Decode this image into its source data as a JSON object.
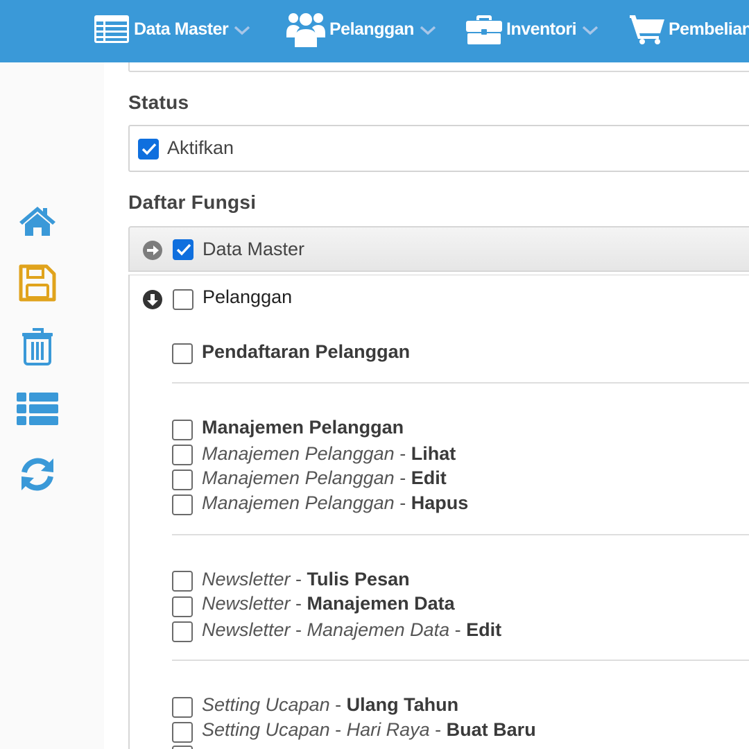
{
  "nav": {
    "items": [
      {
        "label": "Data Master",
        "icon": "table-list-icon"
      },
      {
        "label": "Pelanggan",
        "icon": "users-icon"
      },
      {
        "label": "Inventori",
        "icon": "briefcase-icon"
      },
      {
        "label": "Pembelian",
        "icon": "cart-icon"
      }
    ]
  },
  "sidebar": {
    "items": [
      {
        "icon": "home-icon",
        "color": "#3a99d8"
      },
      {
        "icon": "save-icon",
        "color": "#e0a31c"
      },
      {
        "icon": "trash-icon",
        "color": "#3a99d8"
      },
      {
        "icon": "list-icon",
        "color": "#3a99d8"
      },
      {
        "icon": "refresh-icon",
        "color": "#3a99d8"
      }
    ]
  },
  "form": {
    "status_label": "Status",
    "status_checkbox_label": "Aktifkan",
    "status_checked": true,
    "functions_label": "Daftar Fungsi"
  },
  "groups": {
    "data_master": {
      "label": "Data Master",
      "checked": true,
      "expanded": false
    },
    "pelanggan": {
      "label": "Pelanggan",
      "checked": false,
      "expanded": true
    }
  },
  "permissions": {
    "pendaftaran": {
      "main": "Pendaftaran Pelanggan"
    },
    "manajemen": {
      "main": "Manajemen Pelanggan",
      "lihat": {
        "prefix": "Manajemen Pelanggan",
        "sep": " - ",
        "action": "Lihat"
      },
      "edit": {
        "prefix": "Manajemen Pelanggan",
        "sep": " - ",
        "action": "Edit"
      },
      "hapus": {
        "prefix": "Manajemen Pelanggan",
        "sep": " - ",
        "action": "Hapus"
      }
    },
    "newsletter": {
      "tulis": {
        "prefix": "Newsletter",
        "sep": " - ",
        "action": "Tulis Pesan"
      },
      "data": {
        "prefix": "Newsletter",
        "sep": " - ",
        "action": "Manajemen Data"
      },
      "data_edit": {
        "prefix": "Newsletter",
        "sep": " - ",
        "mid": "Manajemen Data",
        "sep2": " - ",
        "action": "Edit"
      }
    },
    "ucapan": {
      "ulang_tahun": {
        "prefix": "Setting Ucapan",
        "sep": " - ",
        "action": "Ulang Tahun"
      },
      "hari_raya_baru": {
        "prefix": "Setting Ucapan",
        "sep": " - ",
        "mid": "Hari Raya",
        "sep2": " - ",
        "action": "Buat Baru"
      }
    }
  },
  "colors": {
    "nav_bg": "#3a99d8",
    "checkbox_checked": "#0f6fde",
    "save_icon": "#e0a31c",
    "accent": "#3a99d8"
  }
}
